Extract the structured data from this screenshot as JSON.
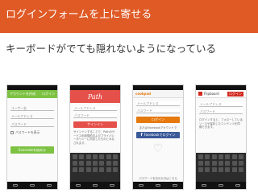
{
  "slide": {
    "title": "ログインフォームを上に寄せる",
    "subtitle": "キーボードがでても隠れないようになっている"
  },
  "colors": {
    "header_bg": "#e05a26",
    "screen1_accent": "#7dc243",
    "path_accent": "#e5504a",
    "flipboard_accent": "#d12a1f",
    "facebook_blue": "#3b5998"
  },
  "screens": {
    "s1": {
      "title": "アカウントを作成",
      "action": "ログイン",
      "fields": [
        "ユーザー名",
        "メールアドレス",
        "パスワード"
      ],
      "option": "パスワードを表示",
      "button": "Evernoteを始める"
    },
    "s2": {
      "logo": "Path",
      "field1": "メールアドレス",
      "field2": "パスワード",
      "button": "サインイン",
      "note": "サインインすることで、Pathのサービス利用規約およびプライバシーポリシーに同意したものとみなされます。"
    },
    "s3": {
      "logo": "cookpad",
      "field1": "メールアドレス",
      "field2": "パスワード",
      "button": "ログイン",
      "fb_note": "またはFacebookアカウントで",
      "fb_button": "Facebookでログイン",
      "forgot": "パスワードを忘れた方はこちら"
    },
    "s4": {
      "app": "Flipboard",
      "action": "ログイン",
      "field1": "メールアドレス",
      "field2": "パスワード",
      "note": "ログインすると、フォローしているソースや保存したコンテンツを同期できます。"
    }
  }
}
